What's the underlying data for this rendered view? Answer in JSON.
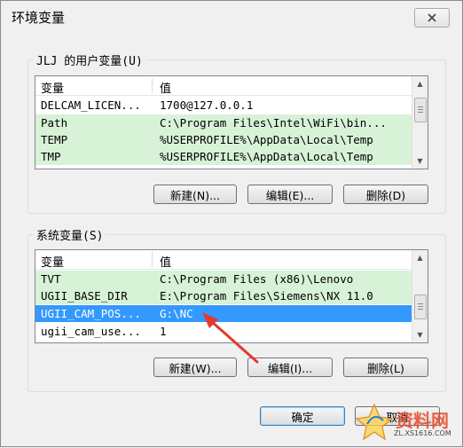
{
  "window": {
    "title": "环境变量",
    "close_icon": "close-x-icon"
  },
  "user_group": {
    "label": "JLJ 的用户变量(U)",
    "columns": {
      "name": "变量",
      "value": "值"
    },
    "rows": [
      {
        "name": "DELCAM_LICEN...",
        "value": "1700@127.0.0.1"
      },
      {
        "name": "Path",
        "value": "C:\\Program Files\\Intel\\WiFi\\bin..."
      },
      {
        "name": "TEMP",
        "value": "%USERPROFILE%\\AppData\\Local\\Temp"
      },
      {
        "name": "TMP",
        "value": "%USERPROFILE%\\AppData\\Local\\Temp"
      }
    ],
    "buttons": {
      "new": "新建(N)...",
      "edit": "编辑(E)...",
      "delete": "删除(D)"
    }
  },
  "system_group": {
    "label": "系统变量(S)",
    "columns": {
      "name": "变量",
      "value": "值"
    },
    "rows": [
      {
        "name": "TVT",
        "value": "C:\\Program Files (x86)\\Lenovo"
      },
      {
        "name": "UGII_BASE_DIR",
        "value": "E:\\Program Files\\Siemens\\NX 11.0"
      },
      {
        "name": "UGII_CAM_POS...",
        "value": "G:\\NC"
      },
      {
        "name": "ugii_cam_use...",
        "value": "1"
      }
    ],
    "buttons": {
      "new": "新建(W)...",
      "edit": "编辑(I)...",
      "delete": "删除(L)"
    }
  },
  "footer": {
    "ok": "确定",
    "cancel": "取消"
  },
  "watermark": {
    "brand": "资料网",
    "url": "ZL.XS1616.COM"
  },
  "colors": {
    "selection": "#3399ff",
    "highlight_row": "#d7f2d7",
    "annotation_arrow": "#e23a2e"
  }
}
